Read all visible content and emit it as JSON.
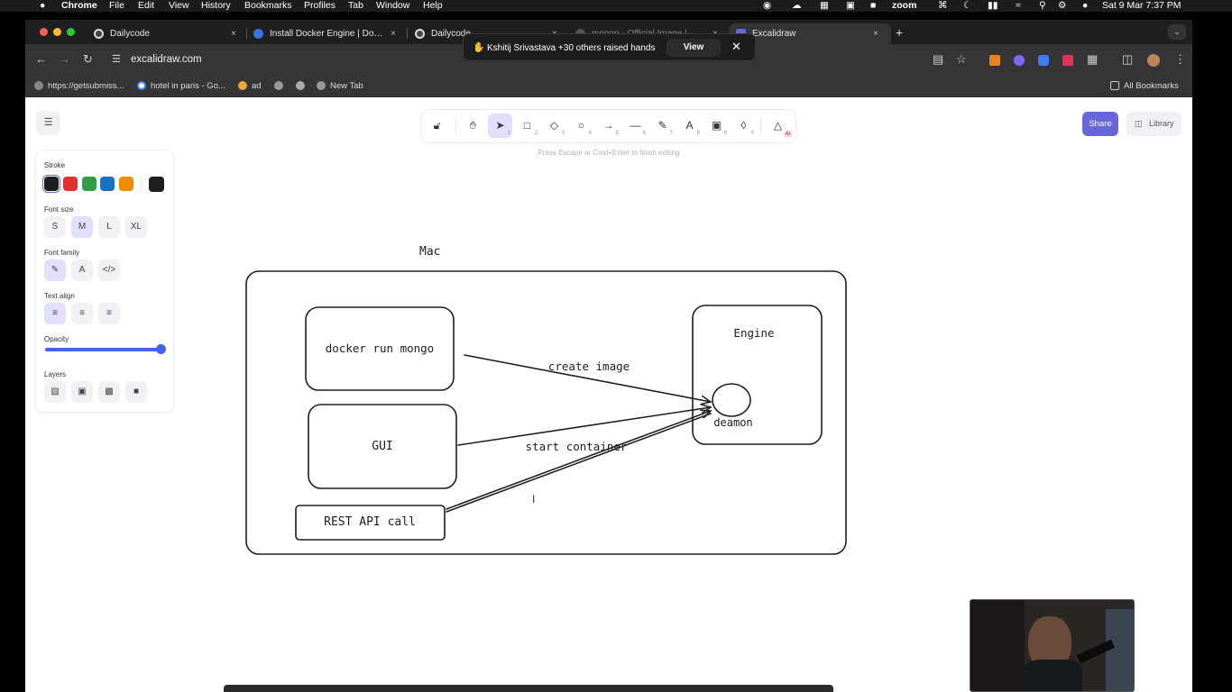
{
  "menubar": {
    "app": "Chrome",
    "items": [
      "File",
      "Edit",
      "View",
      "History",
      "Bookmarks",
      "Profiles",
      "Tab",
      "Window",
      "Help"
    ],
    "zoom_label": "zoom",
    "datetime": "Sat 9 Mar  7:37 PM"
  },
  "tabs": [
    {
      "title": "Dailycode",
      "close": "×"
    },
    {
      "title": "Install Docker Engine | Docke",
      "close": "×"
    },
    {
      "title": "Dailycode",
      "close": "×"
    },
    {
      "title": "mongo - Official Image | Doc",
      "close": "×"
    },
    {
      "title": "Excalidraw",
      "close": "×"
    }
  ],
  "new_tab_label": "+",
  "url": "excalidraw.com",
  "bookmarks": [
    "https://getsubmiss...",
    "hotel in paris - Go...",
    "ad",
    "",
    "",
    "New Tab"
  ],
  "all_bookmarks": "All Bookmarks",
  "notification": {
    "text": "Kshitij Srivastava +30 others raised hands",
    "view": "View",
    "close": "✕",
    "icon": "✋"
  },
  "excalidraw": {
    "hint": "Press Escape or Cmd+Enter to finish editing",
    "share": "Share",
    "library": "Library",
    "tool_keys": [
      "1",
      "2",
      "3",
      "4",
      "5",
      "6",
      "7",
      "8",
      "9",
      "0"
    ],
    "ai_badge": "AI",
    "panel": {
      "stroke": "Stroke",
      "stroke_colors": [
        "#1e1e1e",
        "#e03131",
        "#2f9e44",
        "#1971c2",
        "#f08c00"
      ],
      "current_color": "#1e1e1e",
      "font_size": "Font size",
      "font_sizes": [
        "S",
        "M",
        "L",
        "XL"
      ],
      "font_family": "Font family",
      "text_align": "Text align",
      "opacity": "Opacity",
      "opacity_value": 100,
      "layers": "Layers"
    },
    "diagram": {
      "title": "Mac",
      "box_docker": "docker run mongo",
      "box_gui": "GUI",
      "box_rest": "REST API call",
      "engine": "Engine",
      "daemon": "deamon",
      "arrow_create": "create image",
      "arrow_start": "start container"
    }
  }
}
